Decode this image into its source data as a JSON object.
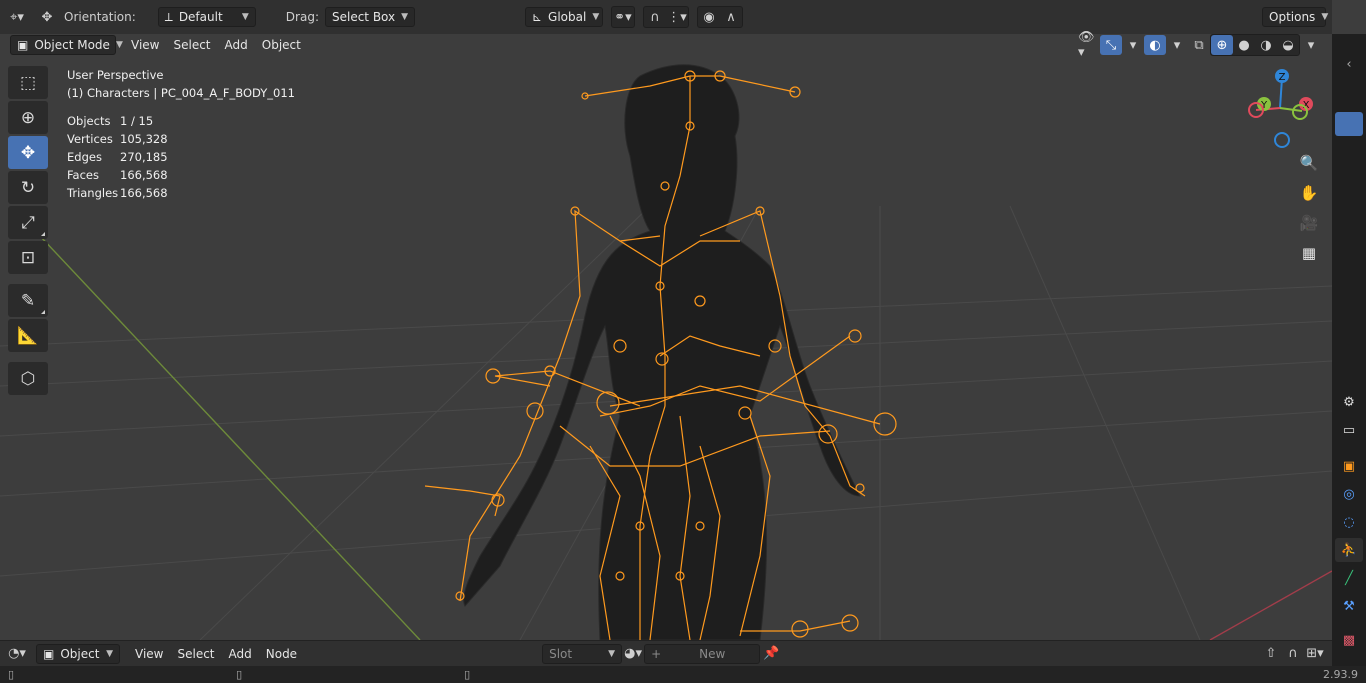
{
  "tool_header": {
    "orientation_label": "Orientation:",
    "orientation_value": "Default",
    "drag_label": "Drag:",
    "drag_value": "Select Box",
    "transform_space": "Global",
    "options_label": "Options"
  },
  "view_header": {
    "mode": "Object Mode",
    "menus": [
      "View",
      "Select",
      "Add",
      "Object"
    ]
  },
  "overlay": {
    "perspective": "User Perspective",
    "collection_object": "(1) Characters | PC_004_A_F_BODY_011",
    "stats": [
      {
        "label": "Objects",
        "value": "1 / 15"
      },
      {
        "label": "Vertices",
        "value": "105,328"
      },
      {
        "label": "Edges",
        "value": "270,185"
      },
      {
        "label": "Faces",
        "value": "166,568"
      },
      {
        "label": "Triangles",
        "value": "166,568"
      }
    ]
  },
  "gizmo": {
    "z": "Z",
    "y": "Y",
    "x": "X"
  },
  "toolbar_icons": [
    "select-box-icon",
    "cursor-icon",
    "move-icon",
    "rotate-icon",
    "scale-icon",
    "transform-icon",
    "annotate-icon",
    "measure-icon",
    "add-cube-icon"
  ],
  "node_header": {
    "mode": "Object",
    "menus": [
      "View",
      "Select",
      "Add",
      "Node"
    ],
    "slot_label": "Slot",
    "new_label": "New"
  },
  "status": {
    "version": "2.93.9"
  },
  "colors": {
    "accent": "#4772b3",
    "armature": "#ff9a1e",
    "header": "#303030",
    "viewport": "#3d3d3d"
  }
}
